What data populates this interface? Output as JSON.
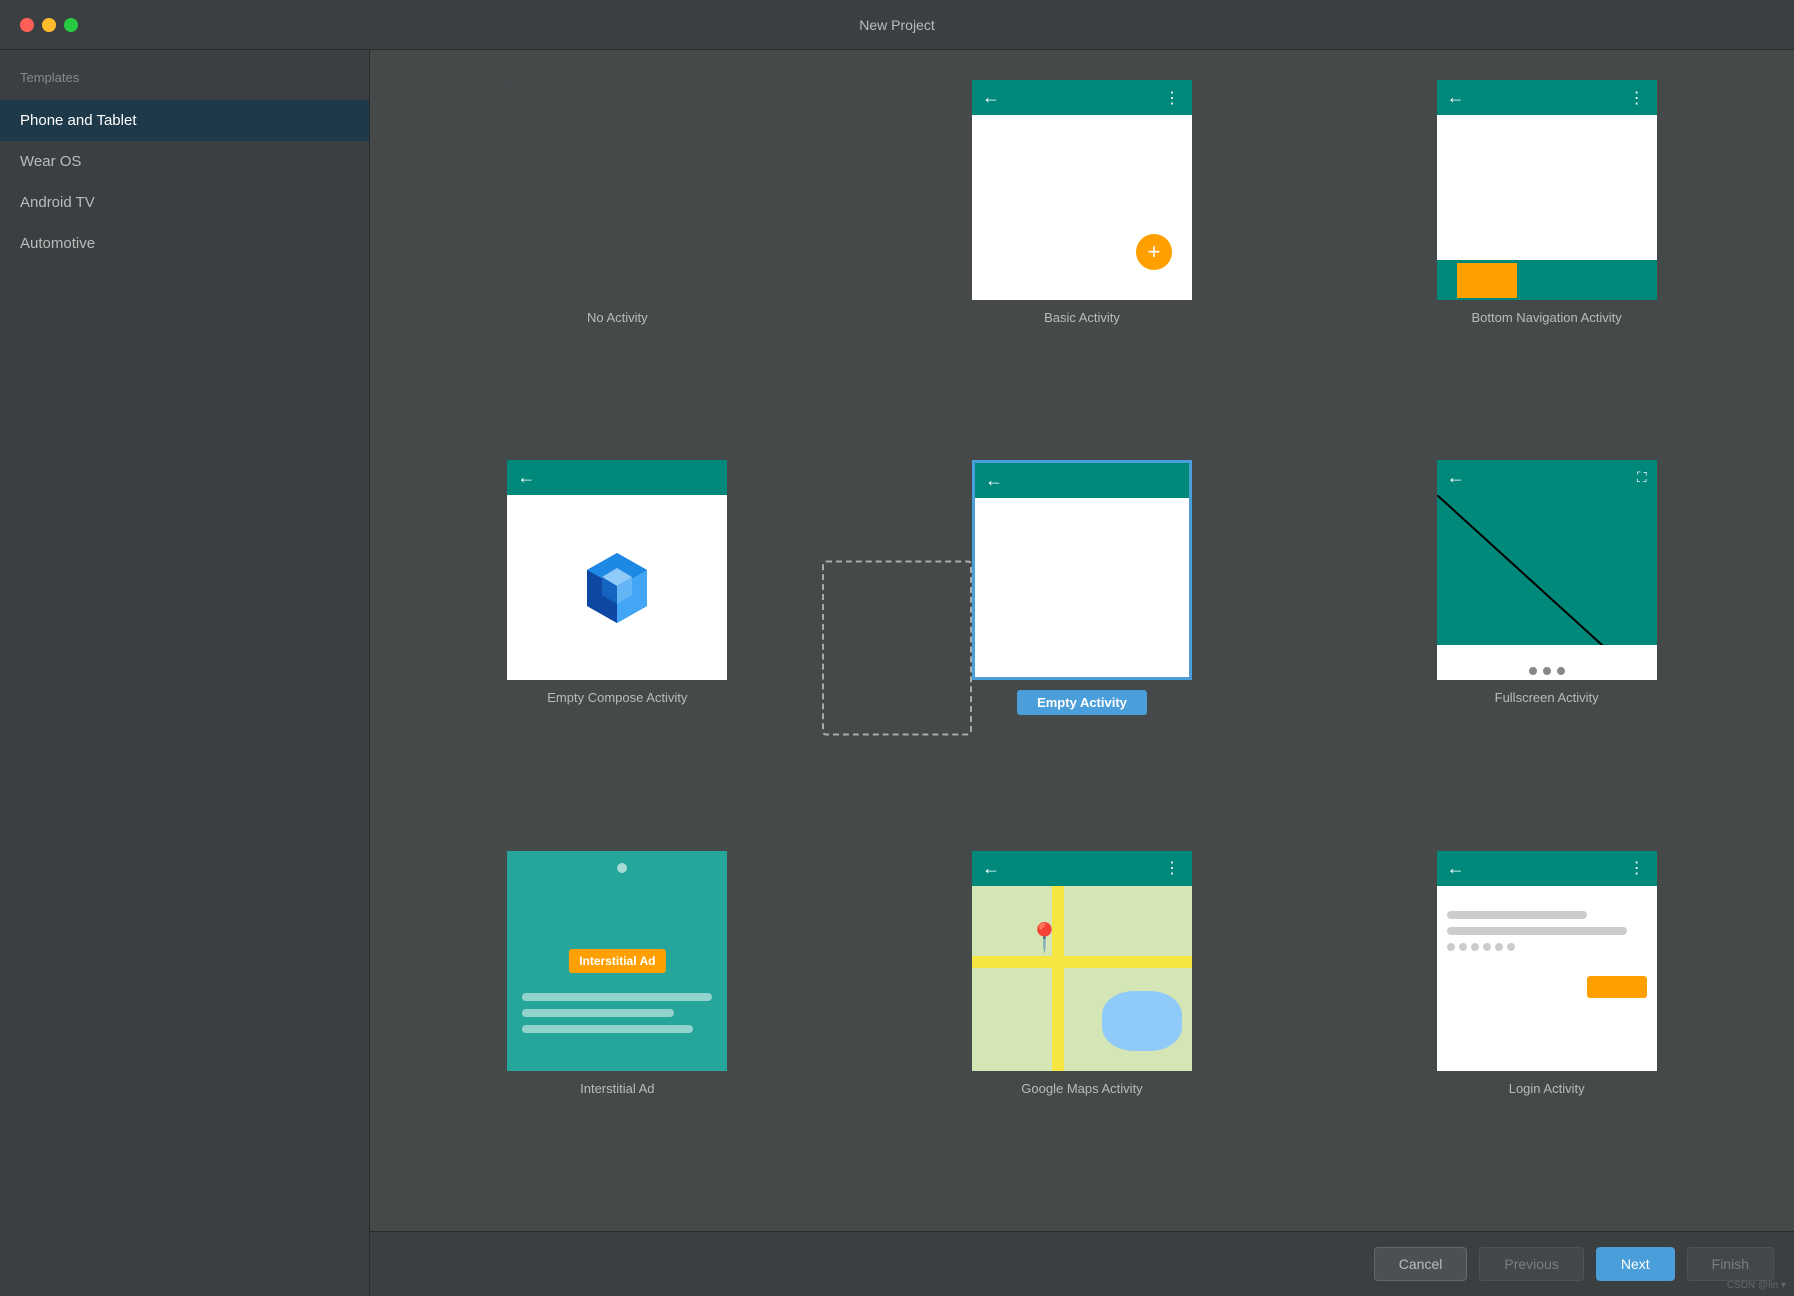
{
  "window": {
    "title": "New Project"
  },
  "sidebar": {
    "section_label": "Templates",
    "items": [
      {
        "id": "phone-tablet",
        "label": "Phone and Tablet",
        "active": true
      },
      {
        "id": "wear-os",
        "label": "Wear OS",
        "active": false
      },
      {
        "id": "android-tv",
        "label": "Android TV",
        "active": false
      },
      {
        "id": "automotive",
        "label": "Automotive",
        "active": false
      }
    ]
  },
  "templates": [
    {
      "id": "no-activity",
      "label": "No Activity",
      "selected": false,
      "type": "no-activity"
    },
    {
      "id": "basic-activity",
      "label": "Basic Activity",
      "selected": false,
      "type": "basic"
    },
    {
      "id": "bottom-nav",
      "label": "Bottom Navigation Activity",
      "selected": false,
      "type": "bottom-nav"
    },
    {
      "id": "empty-compose",
      "label": "Empty Compose Activity",
      "selected": false,
      "type": "compose"
    },
    {
      "id": "empty-activity",
      "label": "Empty Activity",
      "selected": true,
      "type": "empty"
    },
    {
      "id": "fullscreen-activity",
      "label": "Fullscreen Activity",
      "selected": false,
      "type": "fullscreen"
    },
    {
      "id": "interstitial-ad",
      "label": "Interstitial Ad",
      "selected": false,
      "type": "interstitial"
    },
    {
      "id": "google-maps",
      "label": "Google Maps Activity",
      "selected": false,
      "type": "maps"
    },
    {
      "id": "login-activity",
      "label": "Login Activity",
      "selected": false,
      "type": "login"
    }
  ],
  "footer": {
    "cancel_label": "Cancel",
    "previous_label": "Previous",
    "next_label": "Next",
    "finish_label": "Finish"
  }
}
